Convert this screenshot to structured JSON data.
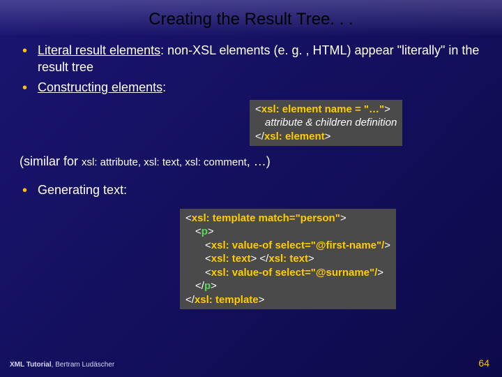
{
  "title": "Creating the Result Tree. . .",
  "bullets": {
    "b1_pre": "Literal result elements",
    "b1_post": ": non-XSL elements (e. g. , HTML) appear \"literally\" in the result tree",
    "b2_pre": "Constructing elements",
    "b2_post": ":",
    "b3": "Generating text:"
  },
  "code1": {
    "l1a": "<",
    "l1b": "xsl: element name = \"…\"",
    "l1c": ">",
    "l2": "attribute & children definition",
    "l3a": "</",
    "l3b": "xsl: element",
    "l3c": ">"
  },
  "similar": {
    "pre": "(similar for ",
    "items": "xsl: attribute, xsl: text, xsl: comment",
    "post": ", …)"
  },
  "code2": {
    "l1a": "<",
    "l1b": "xsl: template match=\"person\"",
    "l1c": ">",
    "l2a": "<",
    "l2b": "p",
    "l2c": ">",
    "l3a": "<",
    "l3b": "xsl: value-of select=\"@first-name\"/",
    "l3c": ">",
    "l4a": "<",
    "l4b": "xsl: text",
    "l4c": "> </",
    "l4d": "xsl: text",
    "l4e": ">",
    "l5a": "<",
    "l5b": "xsl: value-of select=\"@surname\"/",
    "l5c": ">",
    "l6a": "</",
    "l6b": "p",
    "l6c": ">",
    "l7a": "</",
    "l7b": "xsl: template",
    "l7c": ">"
  },
  "footer": {
    "left_bold": "XML Tutorial",
    "left_rest": ", Bertram Ludäscher",
    "page": "64"
  }
}
